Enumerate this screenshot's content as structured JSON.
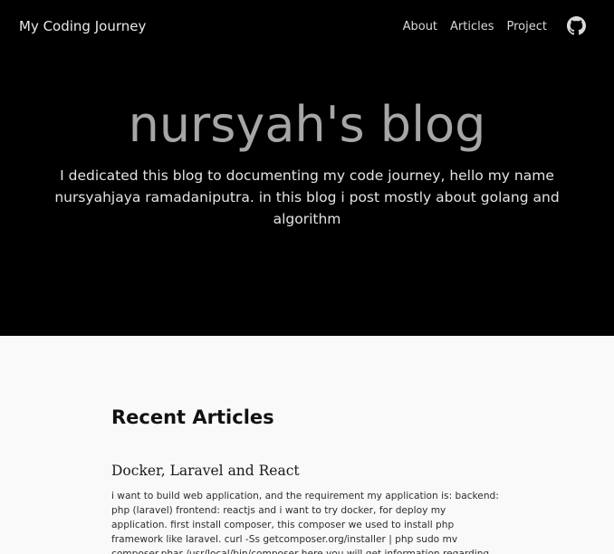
{
  "header": {
    "brand": "My Coding Journey",
    "nav": [
      {
        "label": "About"
      },
      {
        "label": "Articles"
      },
      {
        "label": "Project"
      }
    ],
    "github_icon": "github-icon"
  },
  "hero": {
    "title": "nursyah's blog",
    "subtitle": "I dedicated this blog to documenting my code journey, hello my name nursyahjaya ramadaniputra. in this blog i post mostly about golang and algorithm"
  },
  "recent": {
    "heading": "Recent Articles",
    "articles": [
      {
        "title": "Docker, Laravel and React",
        "excerpt": "i want to build web application, and the requirement my application is: backend: php (laravel) frontend: reactjs and i want to try docker, for deploy my application. first install composer, this composer we used to install php framework like laravel. curl -Ss getcomposer.org/installer | php sudo mv composer.phar /usr/local/bin/composer here you will get information regarding how to install composer in each platform:"
      }
    ]
  },
  "colors": {
    "hero_bg": "#000000",
    "page_bg": "#f9f9f9",
    "hero_title": "#a6a6a6"
  }
}
